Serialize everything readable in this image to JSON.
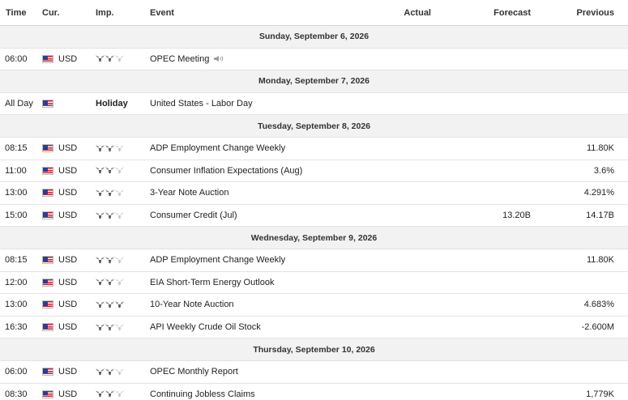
{
  "header": {
    "time": "Time",
    "currency": "Cur.",
    "importance": "Imp.",
    "event": "Event",
    "actual": "Actual",
    "forecast": "Forecast",
    "previous": "Previous"
  },
  "days": [
    {
      "label": "Sunday, September 6, 2026",
      "events": [
        {
          "time": "06:00",
          "currency": "USD",
          "importance": 2,
          "event": "OPEC Meeting",
          "speaker": true,
          "actual": "",
          "forecast": "",
          "previous": ""
        }
      ]
    },
    {
      "label": "Monday, September 7, 2026",
      "events": [
        {
          "time": "All Day",
          "currency": "",
          "holiday": "Holiday",
          "event": "United States - Labor Day",
          "actual": "",
          "forecast": "",
          "previous": ""
        }
      ]
    },
    {
      "label": "Tuesday, September 8, 2026",
      "events": [
        {
          "time": "08:15",
          "currency": "USD",
          "importance": 2,
          "event": "ADP Employment Change Weekly",
          "actual": "",
          "forecast": "",
          "previous": "11.80K"
        },
        {
          "time": "11:00",
          "currency": "USD",
          "importance": 2,
          "event": "Consumer Inflation Expectations (Aug)",
          "actual": "",
          "forecast": "",
          "previous": "3.6%"
        },
        {
          "time": "13:00",
          "currency": "USD",
          "importance": 2,
          "event": "3-Year Note Auction",
          "actual": "",
          "forecast": "",
          "previous": "4.291%"
        },
        {
          "time": "15:00",
          "currency": "USD",
          "importance": 2,
          "event": "Consumer Credit (Jul)",
          "actual": "",
          "forecast": "13.20B",
          "previous": "14.17B"
        }
      ]
    },
    {
      "label": "Wednesday, September 9, 2026",
      "events": [
        {
          "time": "08:15",
          "currency": "USD",
          "importance": 2,
          "event": "ADP Employment Change Weekly",
          "actual": "",
          "forecast": "",
          "previous": "11.80K"
        },
        {
          "time": "12:00",
          "currency": "USD",
          "importance": 2,
          "event": "EIA Short-Term Energy Outlook",
          "actual": "",
          "forecast": "",
          "previous": ""
        },
        {
          "time": "13:00",
          "currency": "USD",
          "importance": 3,
          "event": "10-Year Note Auction",
          "actual": "",
          "forecast": "",
          "previous": "4.683%"
        },
        {
          "time": "16:30",
          "currency": "USD",
          "importance": 2,
          "event": "API Weekly Crude Oil Stock",
          "actual": "",
          "forecast": "",
          "previous": "-2.600M"
        }
      ]
    },
    {
      "label": "Thursday, September 10, 2026",
      "events": [
        {
          "time": "06:00",
          "currency": "USD",
          "importance": 2,
          "event": "OPEC Monthly Report",
          "actual": "",
          "forecast": "",
          "previous": ""
        },
        {
          "time": "08:30",
          "currency": "USD",
          "importance": 2,
          "event": "Continuing Jobless Claims",
          "actual": "",
          "forecast": "",
          "previous": "1,779K"
        }
      ]
    }
  ],
  "colors": {
    "bull_on": "#555555",
    "bull_off": "#c8c8c8",
    "day_bg": "#f2f2f2"
  },
  "icons": {
    "flag": "us-flag-icon",
    "importance": "bull-icon",
    "speaker": "speaker-icon"
  }
}
